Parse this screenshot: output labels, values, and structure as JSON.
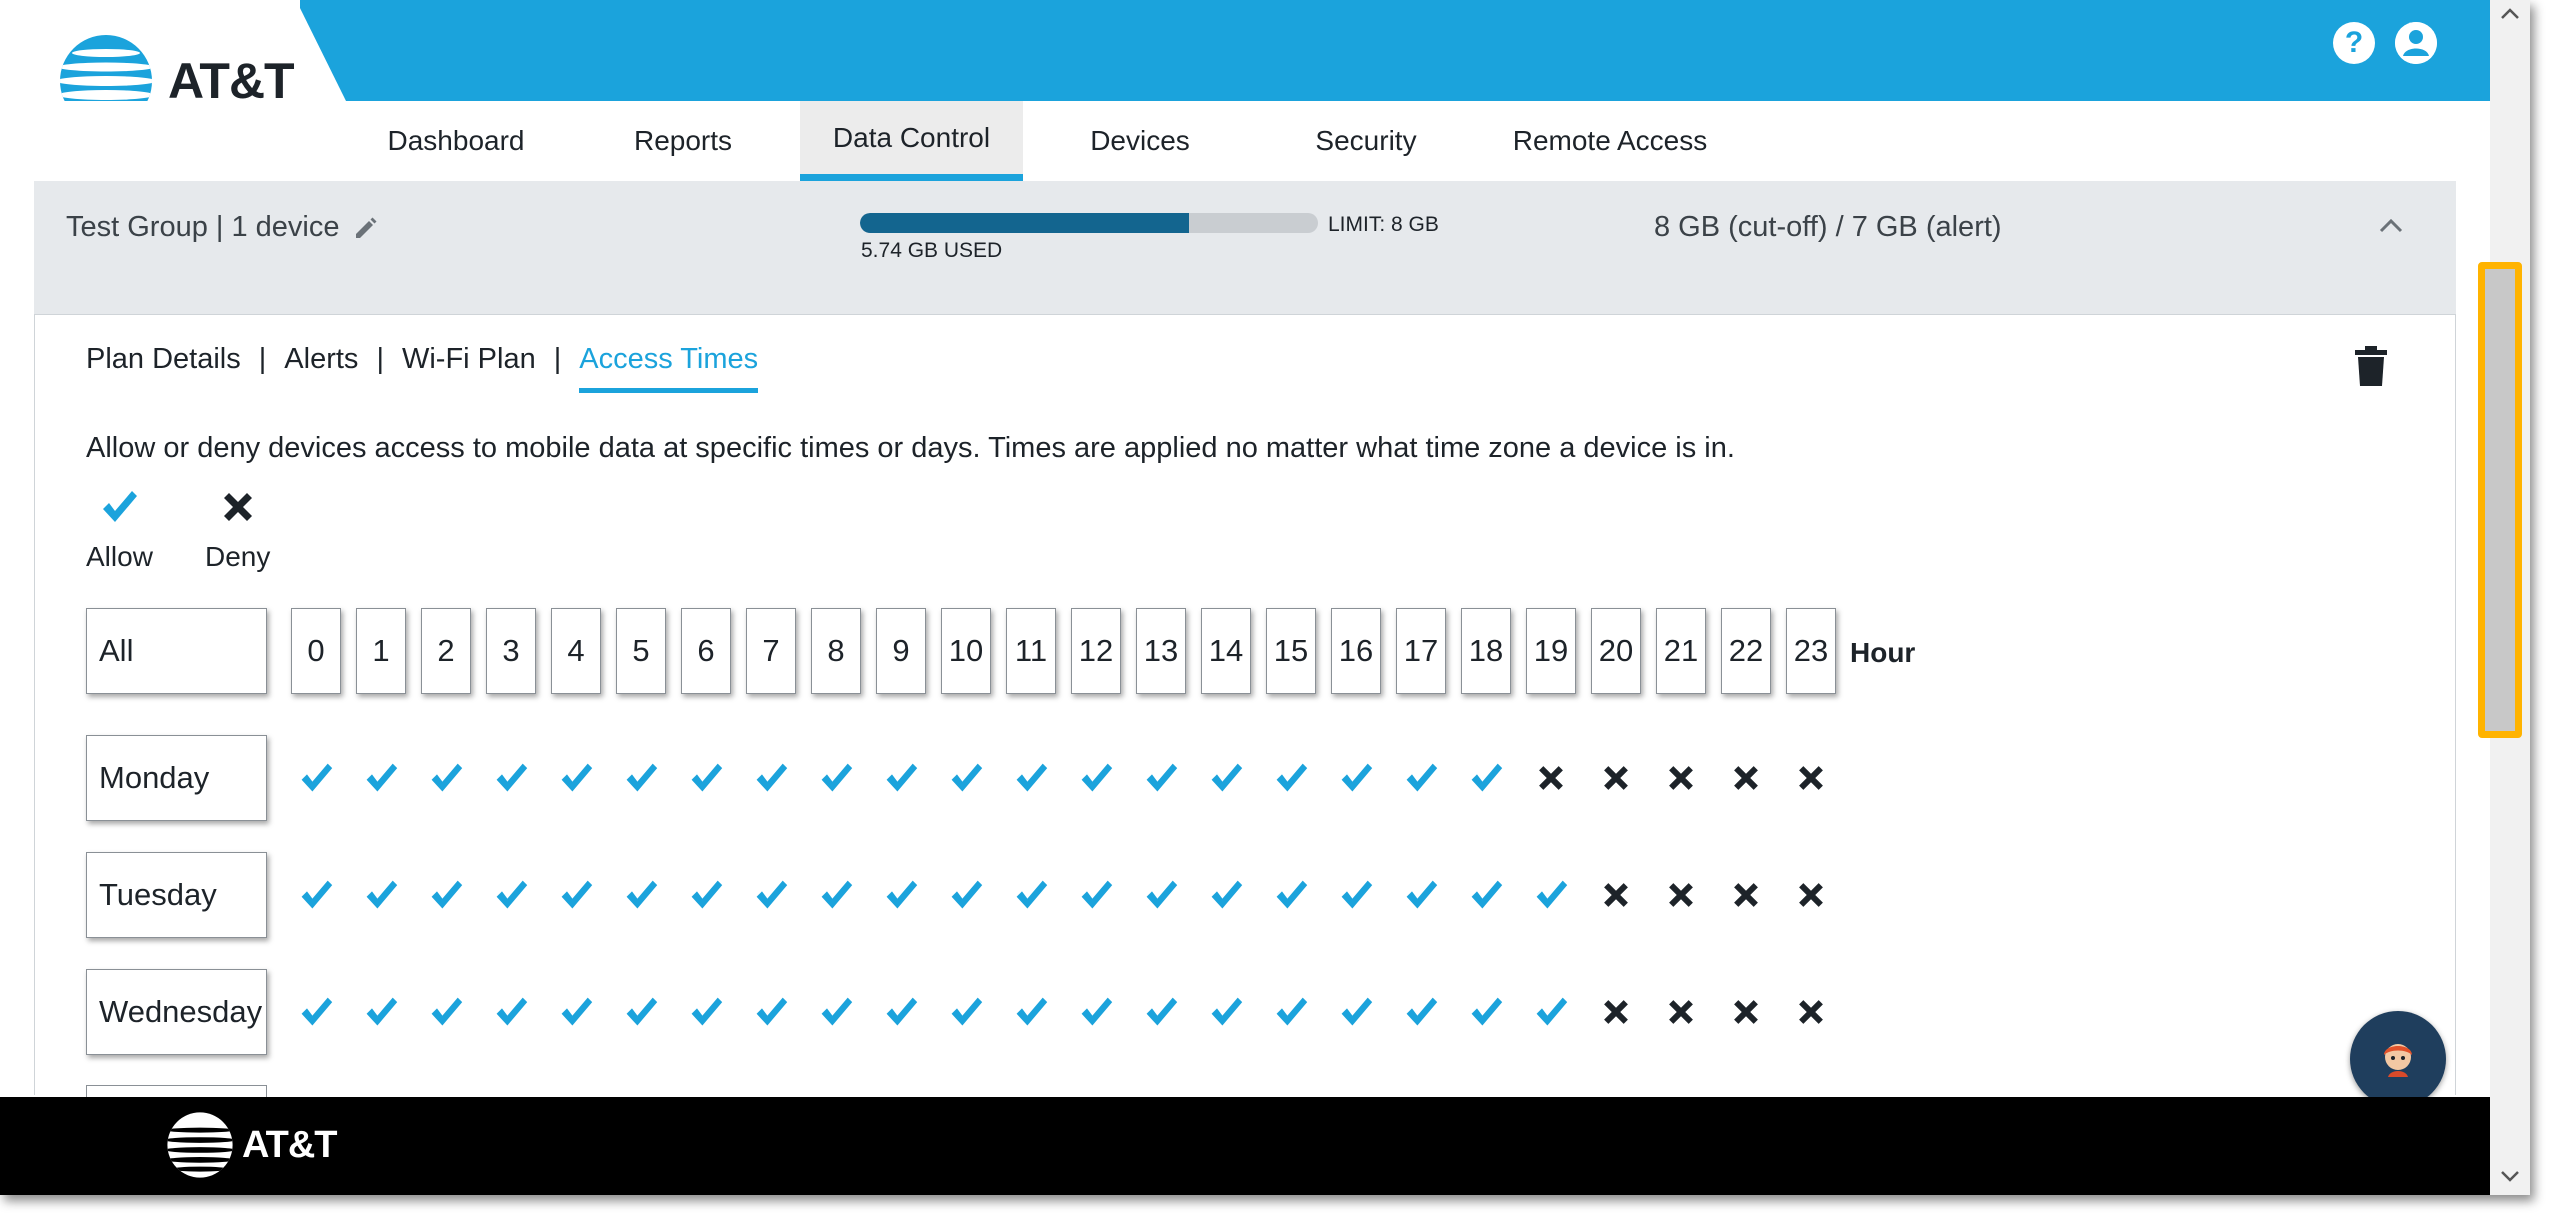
{
  "brand": {
    "name": "AT&T",
    "accent": "#1ba3dc",
    "dark": "#13658f"
  },
  "header": {
    "help_icon": "?",
    "account_icon": "user-circle"
  },
  "nav": {
    "items": [
      {
        "label": "Dashboard"
      },
      {
        "label": "Reports"
      },
      {
        "label": "Data Control",
        "active": true
      },
      {
        "label": "Devices"
      },
      {
        "label": "Security"
      },
      {
        "label": "Remote Access"
      }
    ]
  },
  "group": {
    "name": "Test Group | 1 device",
    "used_label": "5.74 GB USED",
    "used_fraction": 0.7175,
    "limit_label": "LIMIT: 8 GB",
    "cutoff_label": "8 GB (cut-off) / 7 GB (alert)"
  },
  "subtabs": [
    {
      "label": "Plan Details"
    },
    {
      "label": "Alerts"
    },
    {
      "label": "Wi-Fi Plan"
    },
    {
      "label": "Access Times",
      "active": true
    }
  ],
  "subtab_separator": "|",
  "description": "Allow or deny devices access to mobile data at specific times or days. Times are applied no matter what time zone a device is in.",
  "legend": {
    "allow": "Allow",
    "deny": "Deny"
  },
  "schedule": {
    "all_label": "All",
    "hour_label": "Hour",
    "hours": [
      "0",
      "1",
      "2",
      "3",
      "4",
      "5",
      "6",
      "7",
      "8",
      "9",
      "10",
      "11",
      "12",
      "13",
      "14",
      "15",
      "16",
      "17",
      "18",
      "19",
      "20",
      "21",
      "22",
      "23"
    ],
    "days": [
      {
        "name": "Monday",
        "cells": [
          "allow",
          "allow",
          "allow",
          "allow",
          "allow",
          "allow",
          "allow",
          "allow",
          "allow",
          "allow",
          "allow",
          "allow",
          "allow",
          "allow",
          "allow",
          "allow",
          "allow",
          "allow",
          "allow",
          "deny",
          "deny",
          "deny",
          "deny",
          "deny"
        ]
      },
      {
        "name": "Tuesday",
        "cells": [
          "allow",
          "allow",
          "allow",
          "allow",
          "allow",
          "allow",
          "allow",
          "allow",
          "allow",
          "allow",
          "allow",
          "allow",
          "allow",
          "allow",
          "allow",
          "allow",
          "allow",
          "allow",
          "allow",
          "allow",
          "deny",
          "deny",
          "deny",
          "deny"
        ]
      },
      {
        "name": "Wednesday",
        "cells": [
          "allow",
          "allow",
          "allow",
          "allow",
          "allow",
          "allow",
          "allow",
          "allow",
          "allow",
          "allow",
          "allow",
          "allow",
          "allow",
          "allow",
          "allow",
          "allow",
          "allow",
          "allow",
          "allow",
          "allow",
          "deny",
          "deny",
          "deny",
          "deny"
        ]
      }
    ]
  },
  "footer": {
    "brand": "AT&T"
  }
}
